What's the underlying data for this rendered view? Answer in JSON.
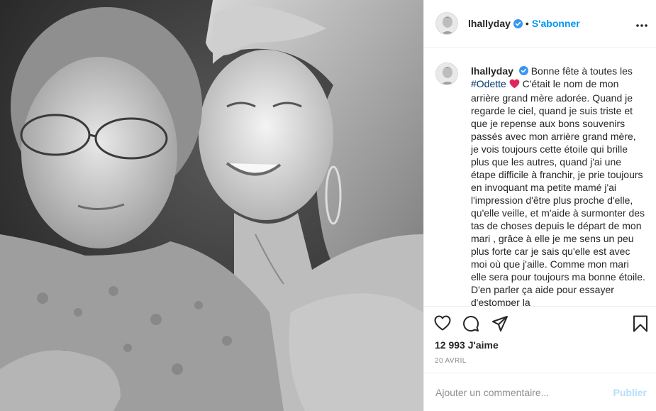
{
  "post": {
    "username": "lhallyday",
    "follow_label": "S'abonner",
    "separator": "•",
    "caption_author": "lhallyday",
    "caption_part1": "Bonne fête à toutes les",
    "caption_mention": "#Odette",
    "caption_part2": "C'était le nom de mon arrière grand mère adorée. Quand je regarde le ciel, quand je suis triste et que je repense aux bons souvenirs passés avec mon arrière grand mère, je vois toujours cette étoile qui brille plus que les autres, quand j'ai une étape difficile à franchir, je prie toujours en invoquant ma petite mamé j'ai l'impression d'être plus proche d'elle, qu'elle veille, et m'aide à surmonter des tas de choses depuis le départ de mon mari , grâce à elle je me sens un peu plus forte car je sais qu'elle est avec moi où que j'aille. Comme mon mari elle sera pour toujours ma bonne étoile. D'en parler ça aide pour essayer d'estomper la",
    "likes": "12 993 J'aime",
    "date": "20 AVRIL",
    "comment_placeholder": "Ajouter un commentaire...",
    "publish_label": "Publier"
  },
  "icons": {
    "verified": "verified-badge-icon",
    "more": "more-options-icon",
    "heart": "heart-icon",
    "comment": "comment-icon",
    "share": "share-icon",
    "save": "bookmark-icon",
    "emoji_heart": "red-heart-emoji"
  },
  "colors": {
    "accent": "#0095f6",
    "verified": "#3897f0",
    "publish_disabled": "#b2dffc",
    "heart_emoji": "#e0245e"
  }
}
